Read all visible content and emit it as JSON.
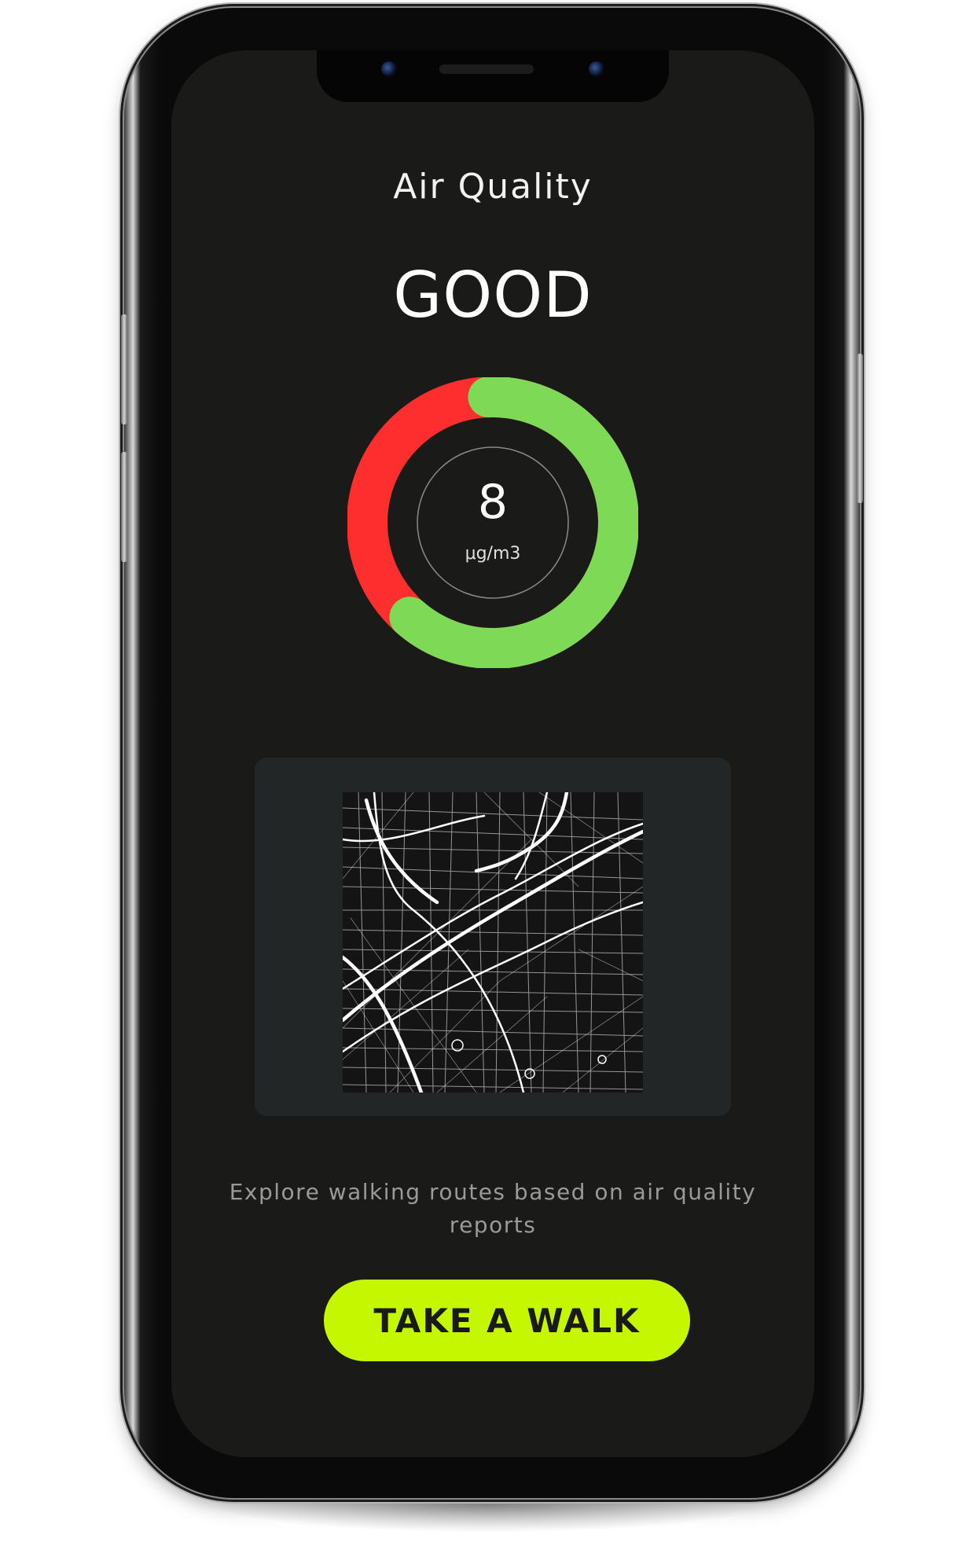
{
  "screen": {
    "title": "Air Quality",
    "status": "GOOD",
    "gauge": {
      "value": "8",
      "unit": "μg/m3",
      "good_fraction": 0.62,
      "good_color": "#7ed957",
      "bad_color": "#ff2e2e"
    },
    "map": {
      "icon": "city-street-map"
    },
    "description": "Explore walking routes based on air quality reports",
    "cta_label": "TAKE A WALK",
    "accent_color": "#c5f800"
  }
}
